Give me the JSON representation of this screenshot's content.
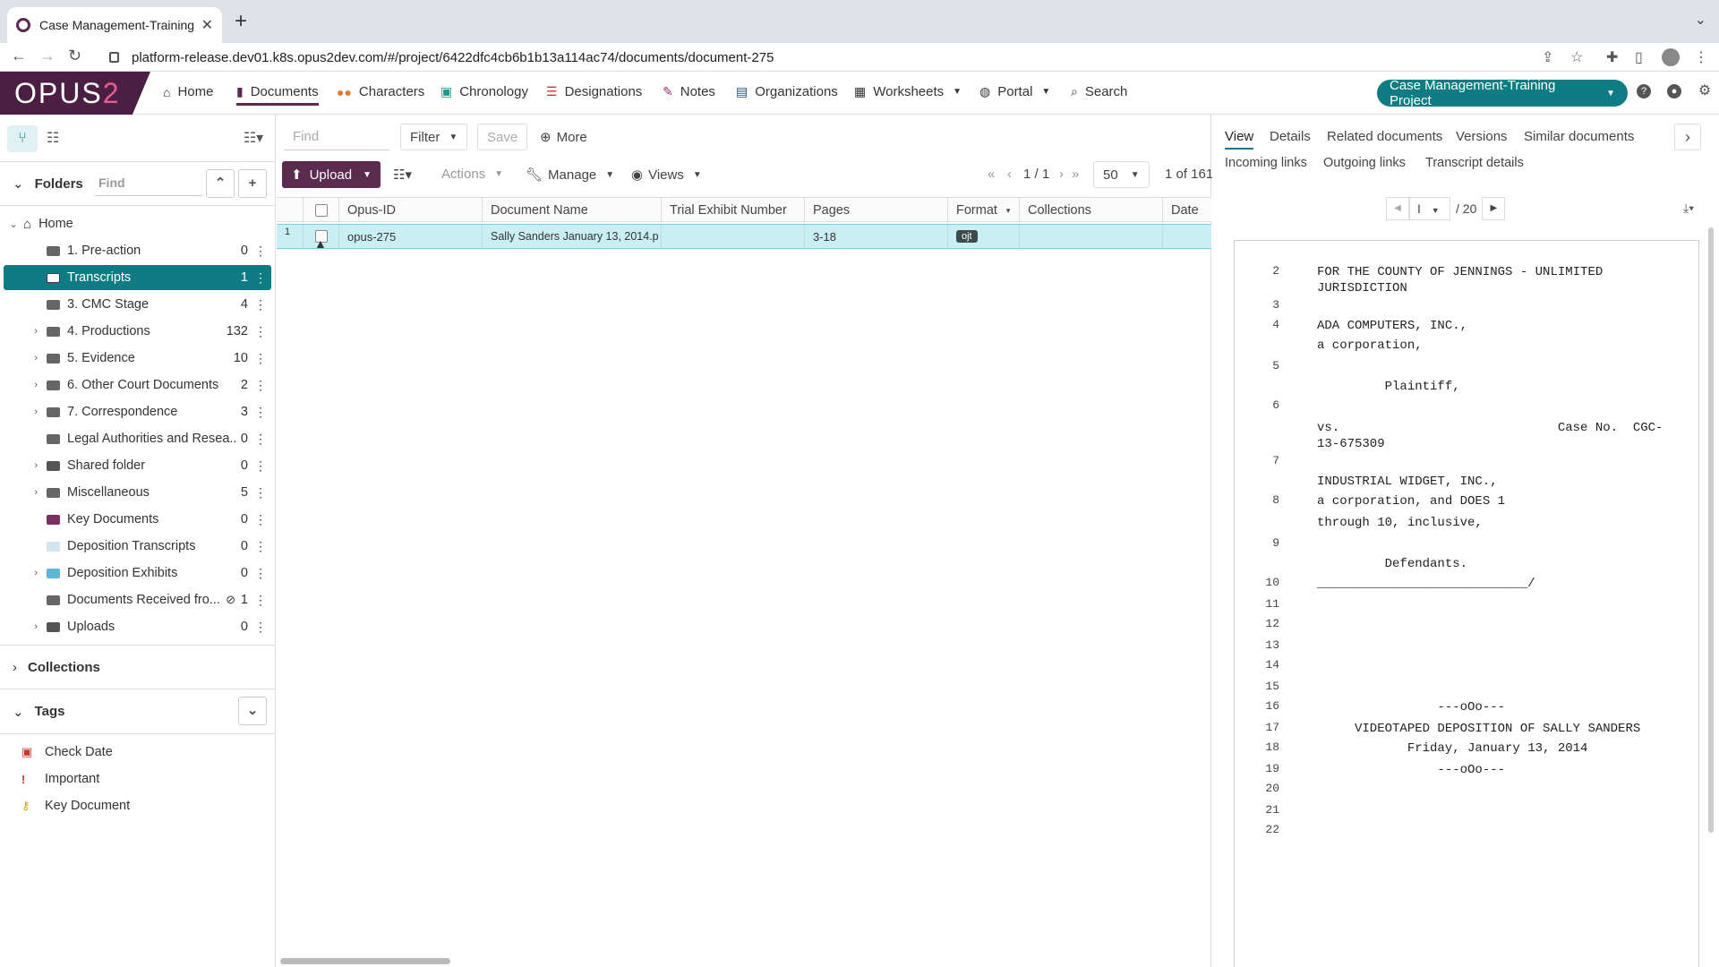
{
  "browser": {
    "tab_title": "Case Management-Training Pr",
    "url": "platform-release.dev01.k8s.opus2dev.com/#/project/6422dfc4cb6b1b13a114ac74/documents/document-275"
  },
  "app": {
    "logo": "OPUS2",
    "nav": [
      {
        "label": "Home"
      },
      {
        "label": "Documents"
      },
      {
        "label": "Characters"
      },
      {
        "label": "Chronology"
      },
      {
        "label": "Designations"
      },
      {
        "label": "Notes"
      },
      {
        "label": "Organizations"
      },
      {
        "label": "Worksheets"
      },
      {
        "label": "Portal"
      },
      {
        "label": "Search"
      }
    ],
    "project": "Case Management-Training Project",
    "accent": "#0f7b83",
    "brand": "#5a2a4f"
  },
  "sidebar": {
    "folders_title": "Folders",
    "find_placeholder": "Find",
    "tree": [
      {
        "label": "Home",
        "count": ""
      },
      {
        "label": "1. Pre-action",
        "count": "0"
      },
      {
        "label": "Transcripts",
        "count": "1"
      },
      {
        "label": "3. CMC Stage",
        "count": "4"
      },
      {
        "label": "4. Productions",
        "count": "132"
      },
      {
        "label": "5. Evidence",
        "count": "10"
      },
      {
        "label": "6. Other Court Documents",
        "count": "2"
      },
      {
        "label": "7. Correspondence",
        "count": "3"
      },
      {
        "label": "Legal Authorities and Resea...",
        "count": "0"
      },
      {
        "label": "Shared folder",
        "count": "0"
      },
      {
        "label": "Miscellaneous",
        "count": "5"
      },
      {
        "label": "Key Documents",
        "count": "0"
      },
      {
        "label": "Deposition Transcripts",
        "count": "0"
      },
      {
        "label": "Deposition Exhibits",
        "count": "0"
      },
      {
        "label": "Documents Received fro...",
        "count": "1"
      },
      {
        "label": "Uploads",
        "count": "0"
      }
    ],
    "collections_title": "Collections",
    "tags_title": "Tags",
    "tags": [
      {
        "label": "Check Date"
      },
      {
        "label": "Important"
      },
      {
        "label": "Key Document"
      }
    ]
  },
  "toolbar": {
    "find_placeholder": "Find",
    "filter": "Filter",
    "save": "Save",
    "more": "More",
    "upload": "Upload",
    "actions": "Actions",
    "manage": "Manage",
    "views": "Views",
    "page": "1 / 1",
    "page_size": "50",
    "count": "1 of 161"
  },
  "grid": {
    "columns": [
      "Opus-ID",
      "Document Name",
      "Trial Exhibit Number",
      "Pages",
      "Format",
      "Collections",
      "Date"
    ],
    "rows": [
      {
        "num": "1",
        "opus_id": "opus-275",
        "name": "Sally Sanders January 13, 2014.p",
        "exhibit": "",
        "pages": "3-18",
        "format": "ojt",
        "collections": "",
        "date": ""
      }
    ]
  },
  "viewer": {
    "tabs": [
      "View",
      "Details",
      "Related documents",
      "Versions",
      "Similar documents"
    ],
    "tabs2": [
      "Incoming links",
      "Outgoing links",
      "Transcript details"
    ],
    "page_current": "I",
    "page_total": "/ 20",
    "lines": [
      {
        "n": "2",
        "t": "FOR THE COUNTY OF JENNINGS - UNLIMITED\nJURISDICTION"
      },
      {
        "n": "3",
        "t": ""
      },
      {
        "n": "4",
        "t": "ADA COMPUTERS, INC.,"
      },
      {
        "n": "",
        "t": "a corporation,"
      },
      {
        "n": "5",
        "t": ""
      },
      {
        "n": "",
        "t": "         Plaintiff,"
      },
      {
        "n": "6",
        "t": ""
      },
      {
        "n": "",
        "t": "vs.                             Case No.  CGC-\n13-675309"
      },
      {
        "n": "7",
        "t": ""
      },
      {
        "n": "",
        "t": "INDUSTRIAL WIDGET, INC.,"
      },
      {
        "n": "8",
        "t": "a corporation, and DOES 1"
      },
      {
        "n": "",
        "t": "through 10, inclusive,"
      },
      {
        "n": "9",
        "t": ""
      },
      {
        "n": "",
        "t": "         Defendants."
      },
      {
        "n": "10",
        "t": "____________________________/"
      },
      {
        "n": "11",
        "t": ""
      },
      {
        "n": "12",
        "t": ""
      },
      {
        "n": "13",
        "t": ""
      },
      {
        "n": "14",
        "t": ""
      },
      {
        "n": "15",
        "t": ""
      },
      {
        "n": "16",
        "t": "                ---oOo---"
      },
      {
        "n": "17",
        "t": "     VIDEOTAPED DEPOSITION OF SALLY SANDERS"
      },
      {
        "n": "18",
        "t": "            Friday, January 13, 2014"
      },
      {
        "n": "19",
        "t": "                ---oOo---"
      },
      {
        "n": "20",
        "t": ""
      },
      {
        "n": "21",
        "t": ""
      },
      {
        "n": "22",
        "t": ""
      }
    ]
  }
}
